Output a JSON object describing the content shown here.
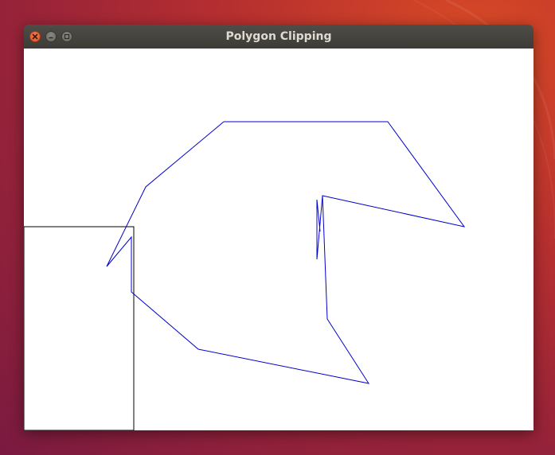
{
  "window": {
    "title": "Polygon Clipping"
  },
  "controls": {
    "close_icon": "close-icon",
    "minimize_icon": "minimize-icon",
    "maximize_icon": "maximize-icon"
  },
  "drawing": {
    "clip_window_color": "#000000",
    "polygon_color": "#0000cc"
  }
}
